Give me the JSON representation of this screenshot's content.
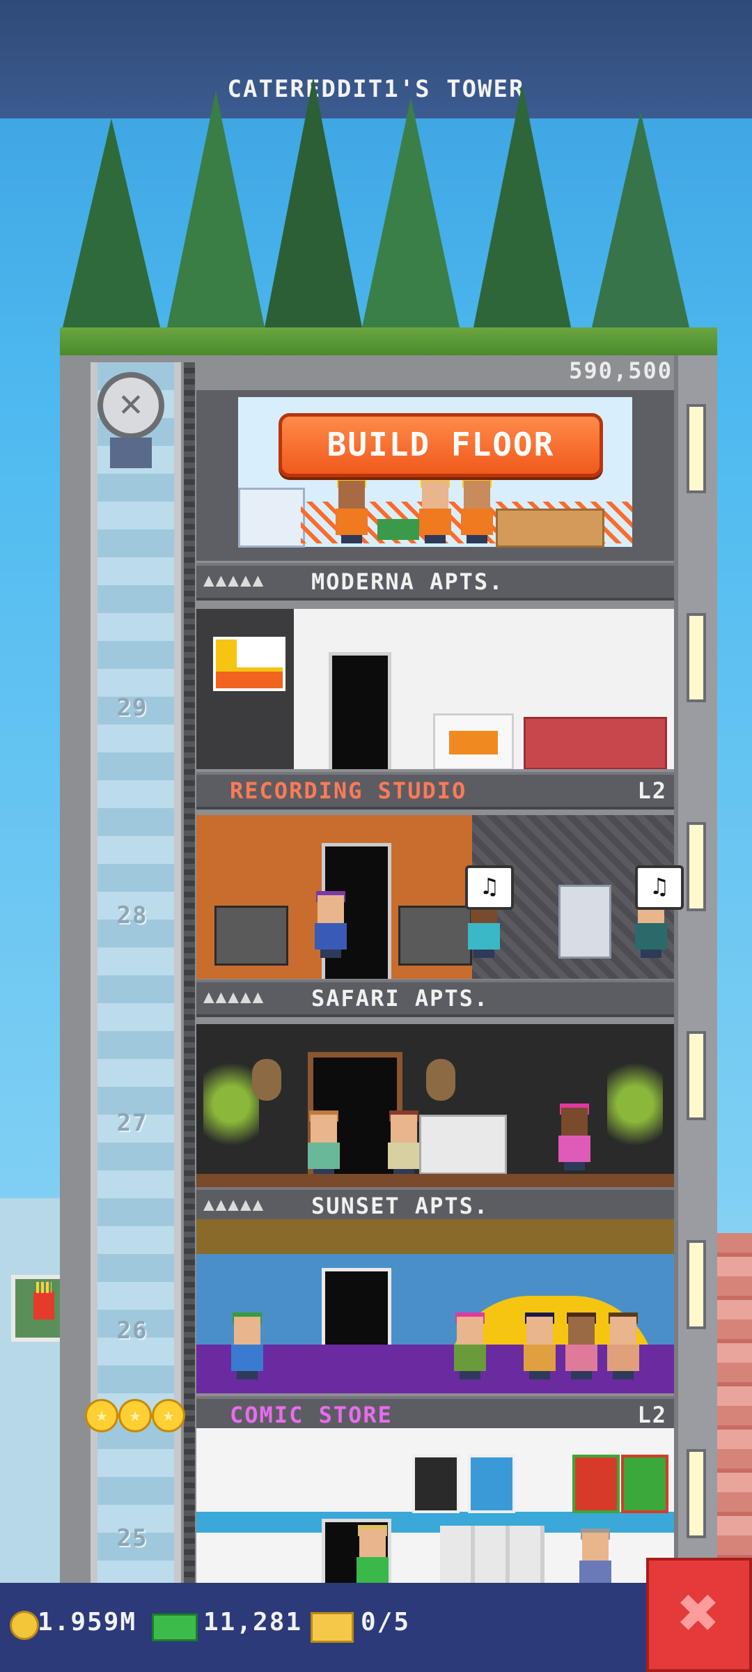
{
  "header": {
    "tower_title": "CATEREDDIT1'S TOWER"
  },
  "construction": {
    "cost": "590,500",
    "build_label": "BUILD FLOOR"
  },
  "floors": [
    {
      "name": "MODERNA APTS.",
      "stars": "▲▲▲▲▲",
      "level": ""
    },
    {
      "name": "RECORDING STUDIO",
      "stars": "",
      "level": "L2"
    },
    {
      "name": "SAFARI APTS.",
      "stars": "▲▲▲▲▲",
      "level": ""
    },
    {
      "name": "SUNSET APTS.",
      "stars": "▲▲▲▲▲",
      "level": ""
    },
    {
      "name": "COMIC STORE",
      "stars": "",
      "level": "L2"
    }
  ],
  "floor_numbers": [
    "29",
    "28",
    "27",
    "26",
    "25"
  ],
  "bubbles": [
    "♫",
    "♫"
  ],
  "hud": {
    "coins": "1.959M",
    "bux": "11,281",
    "tickets": "0/5"
  },
  "close_icon": "✖",
  "colors": {
    "sky": "#49b6ef",
    "hud": "#2c3a7a",
    "build_button": "#f05a1c",
    "close_button": "#e43a3a"
  }
}
